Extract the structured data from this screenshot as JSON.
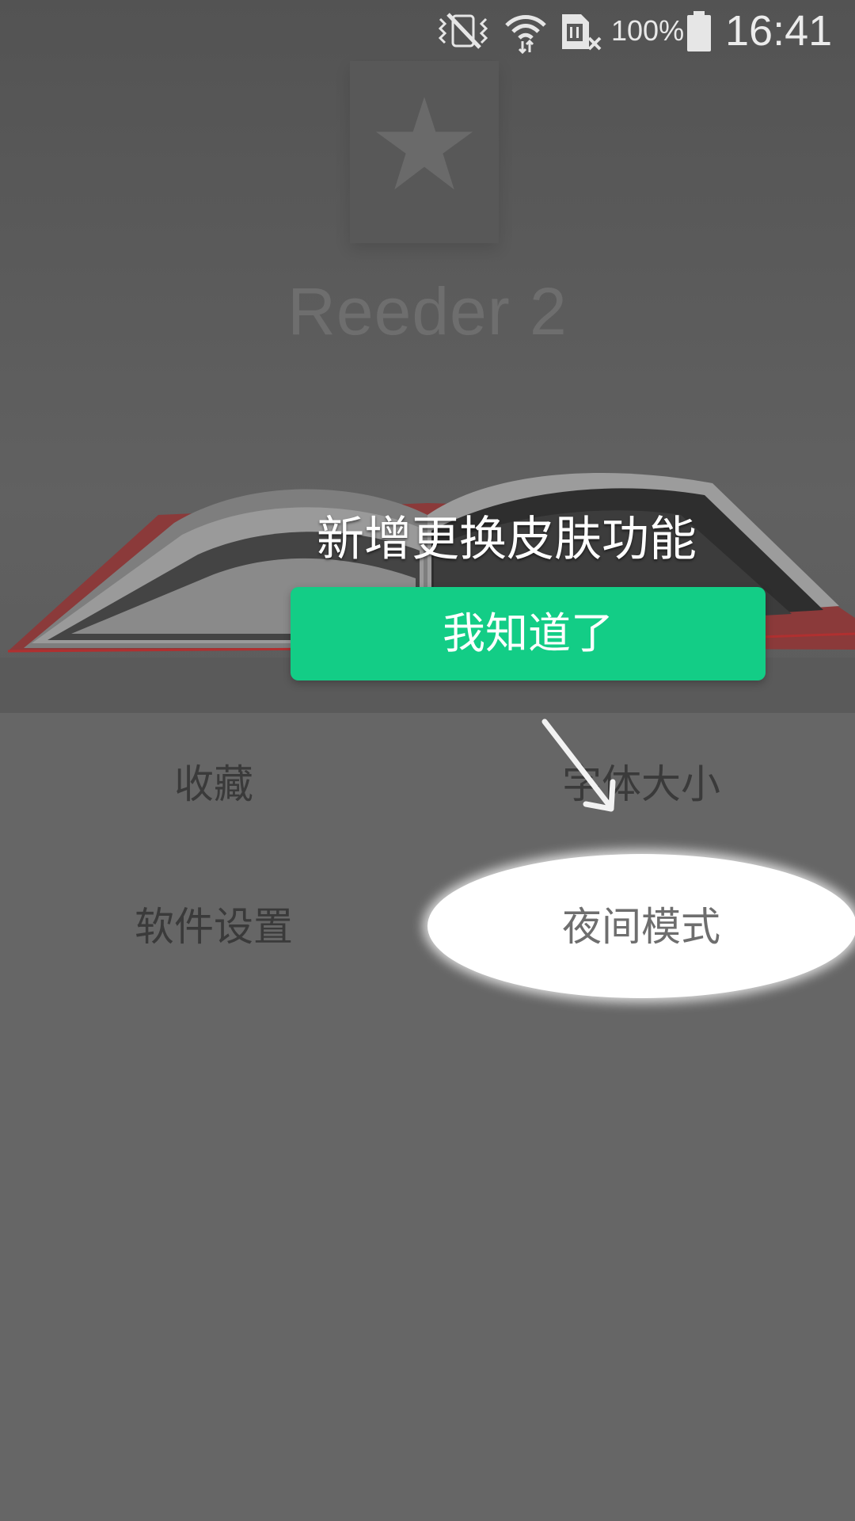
{
  "status_bar": {
    "battery_percent": "100%",
    "time": "16:41",
    "icons": [
      "vibrate-mute-icon",
      "wifi-icon",
      "sim-card-no-signal-icon",
      "battery-icon"
    ]
  },
  "app": {
    "logo_text": "Reeder 2"
  },
  "onboarding": {
    "message": "新增更换皮肤功能",
    "confirm_label": "我知道了"
  },
  "menu": {
    "items": [
      {
        "label": "收藏"
      },
      {
        "label": "字体大小"
      },
      {
        "label": "软件设置"
      },
      {
        "label": "夜间模式",
        "highlighted": true
      }
    ]
  },
  "colors": {
    "accent": "#13cd86",
    "background": "#666666",
    "spotlight": "#ffffff"
  }
}
